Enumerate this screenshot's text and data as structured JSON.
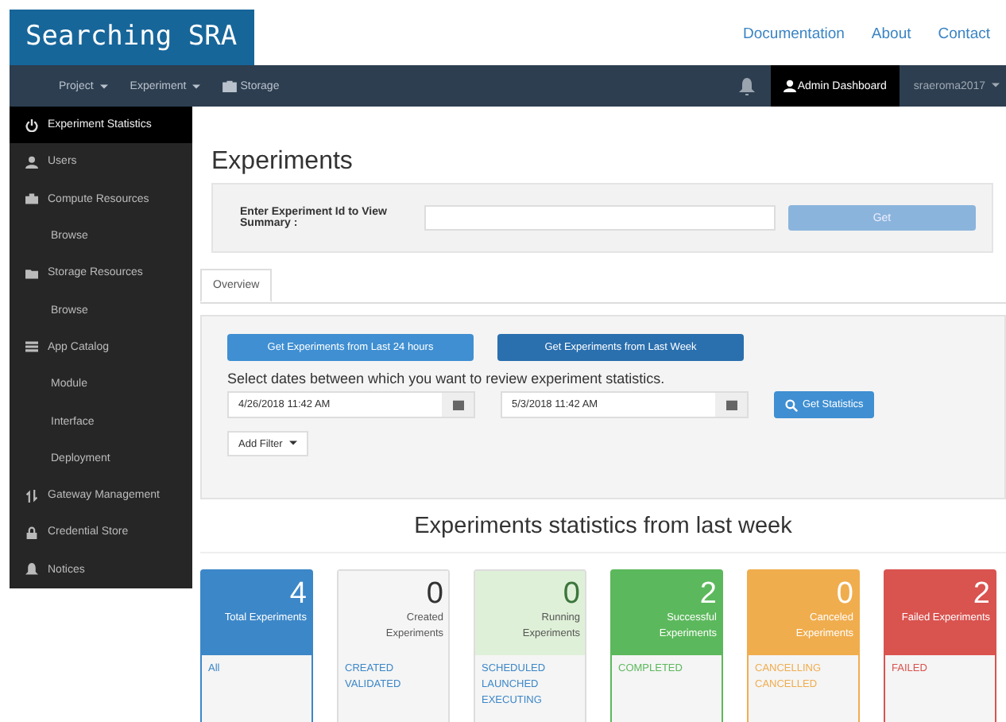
{
  "logo": "Searching SRA",
  "top_links": [
    "Documentation",
    "About",
    "Contact"
  ],
  "navbar": {
    "left": [
      {
        "label": "Project",
        "kind": "dropdown"
      },
      {
        "label": "Experiment",
        "kind": "dropdown"
      },
      {
        "label": "Storage",
        "kind": "icon"
      }
    ],
    "admin": "Admin Dashboard",
    "user": "sraeroma2017"
  },
  "sidebar": [
    {
      "label": "Experiment Statistics",
      "kind": "section",
      "selected": true
    },
    {
      "label": "Users",
      "kind": "section",
      "selected": false
    },
    {
      "label": "Compute Resources",
      "kind": "section",
      "selected": false
    },
    {
      "label": "Browse",
      "kind": "sub",
      "selected": false
    },
    {
      "label": "Storage Resources",
      "kind": "section",
      "selected": false
    },
    {
      "label": "Browse",
      "kind": "sub",
      "selected": false
    },
    {
      "label": "App Catalog",
      "kind": "section",
      "selected": false
    },
    {
      "label": "Module",
      "kind": "sub",
      "selected": false
    },
    {
      "label": "Interface",
      "kind": "sub",
      "selected": false
    },
    {
      "label": "Deployment",
      "kind": "sub",
      "selected": false
    },
    {
      "label": "Gateway Management",
      "kind": "section",
      "selected": false
    },
    {
      "label": "Credential Store",
      "kind": "section",
      "selected": false
    },
    {
      "label": "Notices",
      "kind": "section",
      "selected": false
    }
  ],
  "title": "Experiments",
  "lookup": {
    "label": "Enter Experiment Id to View Summary :",
    "button": "Get"
  },
  "tabs": [
    {
      "label": "Overview",
      "selected": true
    }
  ],
  "range_buttons": [
    {
      "label": "Get Experiments from Last 24 hours",
      "selected": false
    },
    {
      "label": "Get Experiments from Last Week",
      "selected": true
    }
  ],
  "dates_prompt": "Select dates between which you want to review experiment statistics.",
  "date_from": "4/26/2018 11:42 AM",
  "date_to": "5/3/2018 11:42 AM",
  "stats_button": "Get Statistics",
  "filter_button": "Add Filter",
  "stats_title": "Experiments statistics from last week",
  "cards": [
    {
      "count": "4",
      "label": "Total Experiments",
      "kind": "solid",
      "color": "#3c87c8",
      "statuses": [
        "All"
      ]
    },
    {
      "count": "0",
      "label": "Created Experiments",
      "kind": "light",
      "color": "#333333",
      "statuses": [
        "CREATED",
        "VALIDATED"
      ]
    },
    {
      "count": "0",
      "label": "Running Experiments",
      "kind": "light",
      "color": "#3c763d",
      "statuses": [
        "SCHEDULED",
        "LAUNCHED",
        "EXECUTING"
      ]
    },
    {
      "count": "2",
      "label": "Successful Experiments",
      "kind": "solid",
      "color": "#5cb85c",
      "statuses": [
        "COMPLETED"
      ]
    },
    {
      "count": "0",
      "label": "Canceled Experiments",
      "kind": "solid",
      "color": "#f0ad4e",
      "statuses": [
        "CANCELLING",
        "CANCELLED"
      ]
    },
    {
      "count": "2",
      "label": "Failed Experiments",
      "kind": "solid",
      "color": "#d9534f",
      "statuses": [
        "FAILED"
      ]
    }
  ]
}
